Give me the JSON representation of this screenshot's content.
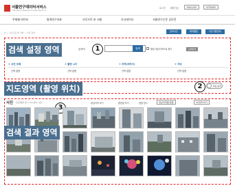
{
  "header": {
    "site_title": "서울연구데이터서비스",
    "site_subtitle": "The Seoul Research Data Service",
    "links": [
      "로그인",
      "회원가입"
    ],
    "buttons": [
      "ENGLISH",
      "SITEMAP"
    ]
  },
  "gnb": [
    "주제별 데이터",
    "통계연구지표",
    "사진으로 본 서울",
    "조사데이터",
    "서울연구논문 공모전"
  ],
  "breadcrumb": "홈 > 사진으로 본 서울 > 사진 검색",
  "sub_tabs": [
    "검색사진",
    "테마앨범",
    "사진기증안내"
  ],
  "search_zone": {
    "label": "검색 설정 영역",
    "marker": "1",
    "keyword_label": "검색어",
    "keyword_value": "",
    "search_button": "검색",
    "checkbox_label": "촬영 대상지역으로 찾기",
    "option_button": "상세검색"
  },
  "filters": [
    {
      "title": "+ 사진 주제",
      "value": "선택 없음"
    },
    {
      "title": "+ 촬영 시기",
      "value": "선택 없음"
    },
    {
      "title": "+ 지역(자치구)",
      "value": "선택 없음"
    },
    {
      "title": "+ 기타",
      "value": "선택 없음"
    }
  ],
  "map_zone": {
    "label": "지도영역 (촬영 위치)",
    "marker": "2",
    "toggle_text": "지도 보기"
  },
  "result_zone": {
    "label": "검색 결과 영역",
    "marker": "3",
    "title": "사진",
    "count": "(검색결과 총 3,412장의 사진)",
    "sort_links": [
      "대상지역 보기",
      "촬영일 보기",
      "정렬 방식"
    ],
    "sort_select": "대상지역별 정렬",
    "per_page": "50개씩 보기"
  },
  "colors": {
    "brand_red": "#d3342b",
    "accent_blue": "#2d6ca2",
    "label_bg": "#4a6f8f",
    "annotation_red": "#e02020"
  }
}
